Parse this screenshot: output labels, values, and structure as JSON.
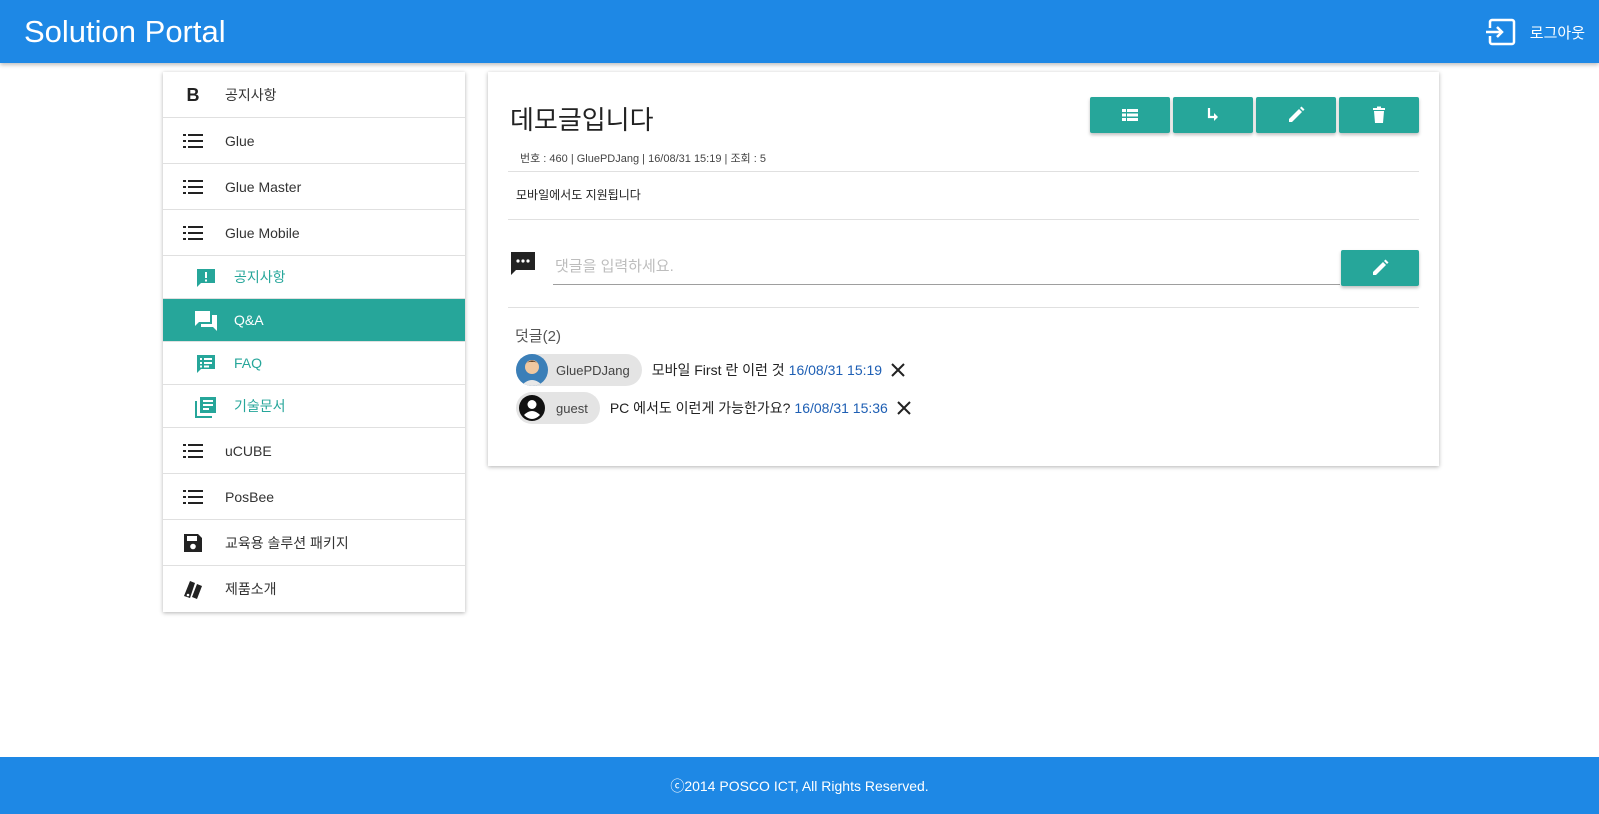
{
  "header": {
    "title": "Solution Portal",
    "logout_label": "로그아웃"
  },
  "sidebar": {
    "items": [
      {
        "label": "공지사항",
        "icon": "bold-b-icon"
      },
      {
        "label": "Glue",
        "icon": "list-icon"
      },
      {
        "label": "Glue Master",
        "icon": "list-icon"
      },
      {
        "label": "Glue Mobile",
        "icon": "list-icon"
      }
    ],
    "sub_items": [
      {
        "label": "공지사항",
        "icon": "announcement-icon"
      },
      {
        "label": "Q&A",
        "icon": "forum-icon",
        "active": true
      },
      {
        "label": "FAQ",
        "icon": "speaker-notes-icon"
      },
      {
        "label": "기술문서",
        "icon": "library-books-icon"
      }
    ],
    "items_after": [
      {
        "label": "uCUBE",
        "icon": "list-icon"
      },
      {
        "label": "PosBee",
        "icon": "list-icon"
      },
      {
        "label": "교육용 솔루션 패키지",
        "icon": "save-icon"
      },
      {
        "label": "제품소개",
        "icon": "swatch-icon"
      }
    ]
  },
  "post": {
    "title": "데모글입니다",
    "meta": "번호 : 460 | GluePDJang | 16/08/31 15:19 | 조회 : 5",
    "body": "모바일에서도 지원됩니다",
    "actions": [
      "list-icon",
      "reply-icon",
      "edit-icon",
      "delete-icon"
    ]
  },
  "comment": {
    "placeholder": "댓글을 입력하세요."
  },
  "replies": {
    "count_label": "덧글(2)",
    "items": [
      {
        "author": "GluePDJang",
        "text": "모바일 First 란 이런 것",
        "date": "16/08/31 15:19"
      },
      {
        "author": "guest",
        "text": "PC 에서도 이런게 가능한가요?",
        "date": "16/08/31 15:36"
      }
    ]
  },
  "footer": {
    "text": "ⓒ2014 POSCO ICT, All Rights Reserved."
  },
  "colors": {
    "primary": "#1e88e5",
    "accent": "#26a69a",
    "date": "#1e5fb4"
  }
}
